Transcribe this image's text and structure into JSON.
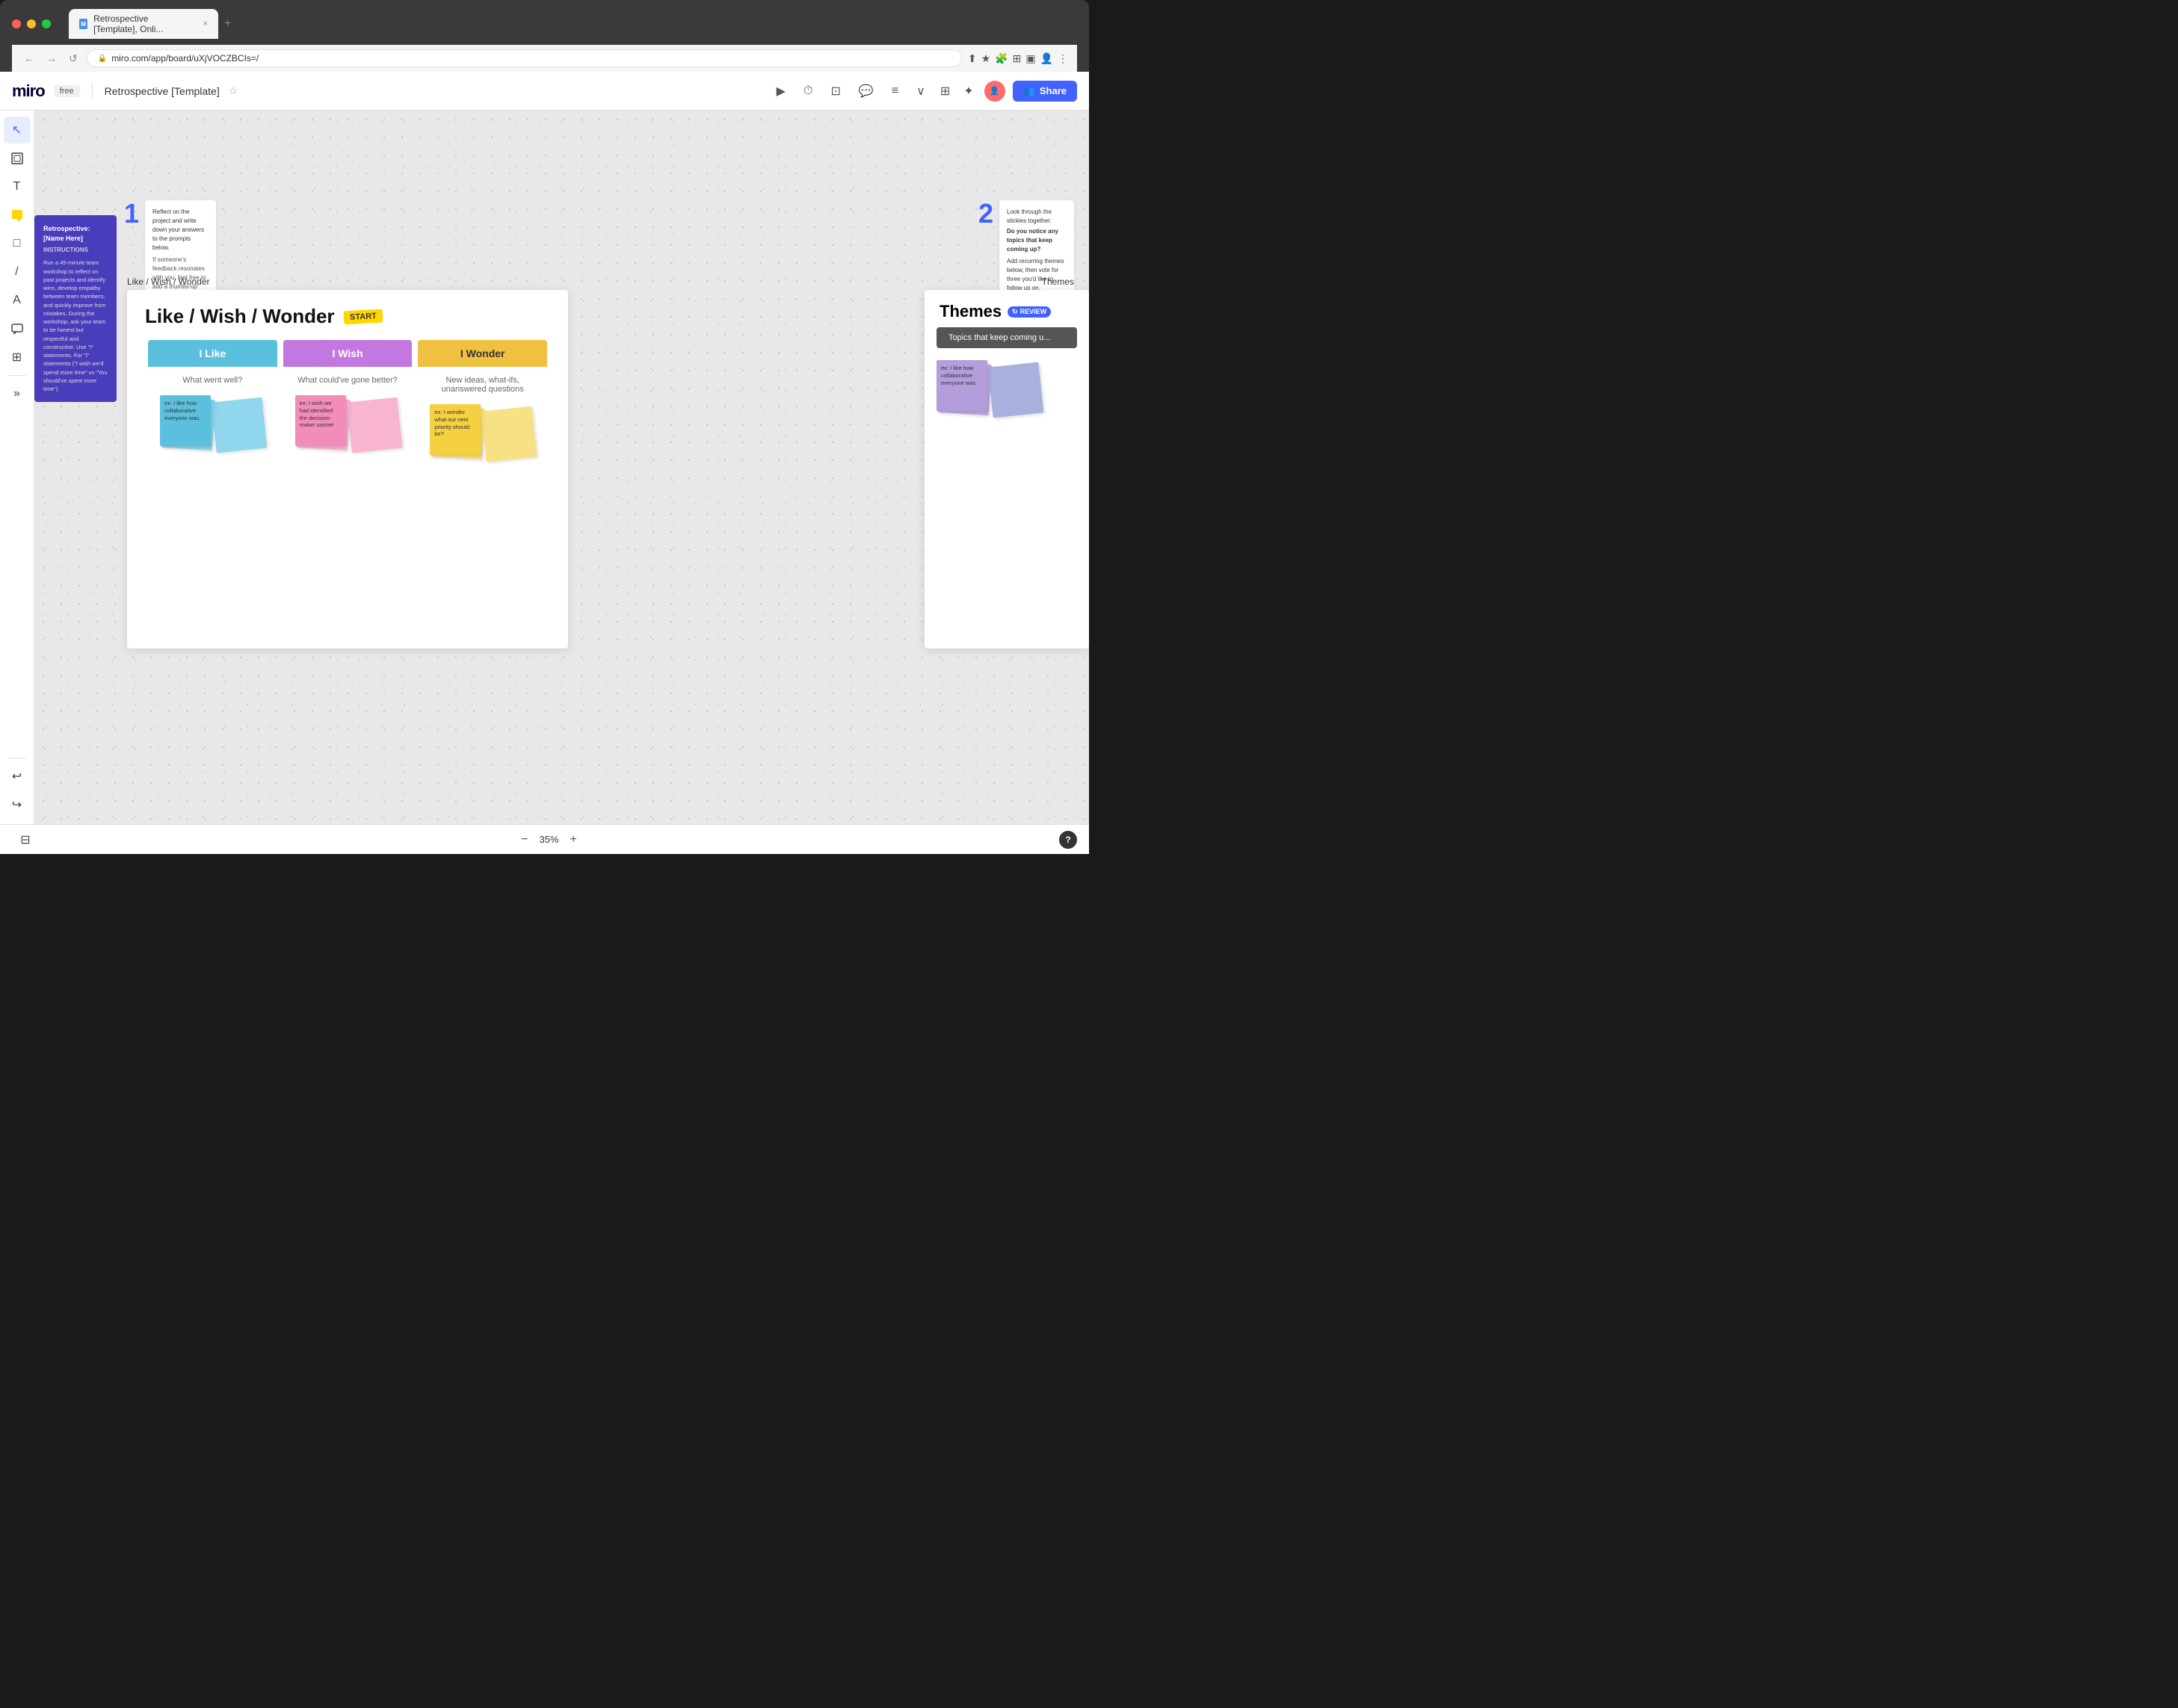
{
  "browser": {
    "tab_title": "Retrospective [Template], Onli...",
    "tab_close": "×",
    "tab_add": "+",
    "url": "miro.com/app/board/uXjVOCZBCIs=/",
    "nav_back": "←",
    "nav_forward": "→",
    "nav_refresh": "↺"
  },
  "header": {
    "logo": "miro",
    "free_badge": "free",
    "board_title": "Retrospective [Template]",
    "share_label": "Share",
    "zoom_modal": "⊞",
    "timer": "◷",
    "chat": "💬",
    "notes": "≡",
    "more": "∨"
  },
  "toolbar": {
    "cursor": "↖",
    "frame": "⊡",
    "text": "T",
    "sticky": "⬜",
    "shapes": "□",
    "pen": "/",
    "eraser": "A",
    "comment": "💬",
    "crop": "⊞",
    "more": "»",
    "undo": "↩",
    "redo": "↪",
    "sidebar": "⊟"
  },
  "canvas": {
    "step1": {
      "number": "1",
      "instruction_title": "Reflect on the project and write down your answers to the prompts below.",
      "instruction_body": "If someone's feedback resonates with you, feel free to add a thumbs-up emoji."
    },
    "step2": {
      "number": "2",
      "instruction_title": "Look through the stickies together.",
      "instruction_bold": "Do you notice any topics that keep coming up?",
      "instruction_body": "Add recurring themes below, then vote for three you'd like to follow up on."
    },
    "section_label": "Like / Wish / Wonder",
    "themes_label": "Themes"
  },
  "main_board": {
    "title": "Like / Wish / Wonder",
    "start_badge": "START",
    "columns": [
      {
        "id": "like",
        "header": "I Like",
        "subtitle": "What went well?",
        "color": "blue",
        "sticky_text": "ex: I like how collaborative everyone was.",
        "sticky_back_color": "blue-light"
      },
      {
        "id": "wish",
        "header": "I Wish",
        "subtitle": "What could've gone better?",
        "color": "pink",
        "sticky_text": "ex: I wish we had identified the decision-maker sooner",
        "sticky_back_color": "pink-light"
      },
      {
        "id": "wonder",
        "header": "I Wonder",
        "subtitle": "New ideas, what-ifs, unanswered questions",
        "color": "yellow",
        "sticky_text": "ex: I wonder what our next priority should be?",
        "sticky_back_color": "yellow-light"
      }
    ]
  },
  "themes_panel": {
    "title": "Themes",
    "review_badge": "REVIEW",
    "topic_bar": "Topics that keep coming u...",
    "sticky_text": "ex: I like how collaborative everyone was.",
    "sticky_back_color": "purple"
  },
  "left_panel": {
    "title": "Retrospective: [Name Here]",
    "subtitle": "Instructions",
    "body": "Run a 45-minute team workshop to reflect on past projects and identify wins, develop empathy between team members, and quickly improve from mistakes. During the workshop, ask your team to be honest but respectful and constructive. Use \"I\" statements. For \"I\" statements (\"I wish we'd spend more time\" vs \"You should've spent more time\")."
  },
  "bottom_bar": {
    "zoom_out": "−",
    "zoom_value": "35%",
    "zoom_in": "+",
    "help": "?"
  }
}
